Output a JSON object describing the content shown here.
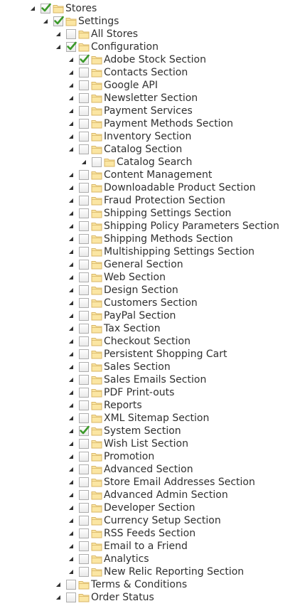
{
  "tree": [
    {
      "label": "Stores",
      "depth": 0,
      "checked": true
    },
    {
      "label": "Settings",
      "depth": 1,
      "checked": true
    },
    {
      "label": "All Stores",
      "depth": 2,
      "checked": false
    },
    {
      "label": "Configuration",
      "depth": 2,
      "checked": true
    },
    {
      "label": "Adobe Stock Section",
      "depth": 3,
      "checked": true
    },
    {
      "label": "Contacts Section",
      "depth": 3,
      "checked": false
    },
    {
      "label": "Google API",
      "depth": 3,
      "checked": false
    },
    {
      "label": "Newsletter Section",
      "depth": 3,
      "checked": false
    },
    {
      "label": "Payment Services",
      "depth": 3,
      "checked": false
    },
    {
      "label": "Payment Methods Section",
      "depth": 3,
      "checked": false
    },
    {
      "label": "Inventory Section",
      "depth": 3,
      "checked": false
    },
    {
      "label": "Catalog Section",
      "depth": 3,
      "checked": false
    },
    {
      "label": "Catalog Search",
      "depth": 4,
      "checked": false
    },
    {
      "label": "Content Management",
      "depth": 3,
      "checked": false
    },
    {
      "label": "Downloadable Product Section",
      "depth": 3,
      "checked": false
    },
    {
      "label": "Fraud Protection Section",
      "depth": 3,
      "checked": false
    },
    {
      "label": "Shipping Settings Section",
      "depth": 3,
      "checked": false
    },
    {
      "label": "Shipping Policy Parameters Section",
      "depth": 3,
      "checked": false
    },
    {
      "label": "Shipping Methods Section",
      "depth": 3,
      "checked": false
    },
    {
      "label": "Multishipping Settings Section",
      "depth": 3,
      "checked": false
    },
    {
      "label": "General Section",
      "depth": 3,
      "checked": false
    },
    {
      "label": "Web Section",
      "depth": 3,
      "checked": false
    },
    {
      "label": "Design Section",
      "depth": 3,
      "checked": false
    },
    {
      "label": "Customers Section",
      "depth": 3,
      "checked": false
    },
    {
      "label": "PayPal Section",
      "depth": 3,
      "checked": false
    },
    {
      "label": "Tax Section",
      "depth": 3,
      "checked": false
    },
    {
      "label": "Checkout Section",
      "depth": 3,
      "checked": false
    },
    {
      "label": "Persistent Shopping Cart",
      "depth": 3,
      "checked": false
    },
    {
      "label": "Sales Section",
      "depth": 3,
      "checked": false
    },
    {
      "label": "Sales Emails Section",
      "depth": 3,
      "checked": false
    },
    {
      "label": "PDF Print-outs",
      "depth": 3,
      "checked": false
    },
    {
      "label": "Reports",
      "depth": 3,
      "checked": false
    },
    {
      "label": "XML Sitemap Section",
      "depth": 3,
      "checked": false
    },
    {
      "label": "System Section",
      "depth": 3,
      "checked": true
    },
    {
      "label": "Wish List Section",
      "depth": 3,
      "checked": false
    },
    {
      "label": "Promotion",
      "depth": 3,
      "checked": false
    },
    {
      "label": "Advanced Section",
      "depth": 3,
      "checked": false
    },
    {
      "label": "Store Email Addresses Section",
      "depth": 3,
      "checked": false
    },
    {
      "label": "Advanced Admin Section",
      "depth": 3,
      "checked": false
    },
    {
      "label": "Developer Section",
      "depth": 3,
      "checked": false
    },
    {
      "label": "Currency Setup Section",
      "depth": 3,
      "checked": false
    },
    {
      "label": "RSS Feeds Section",
      "depth": 3,
      "checked": false
    },
    {
      "label": "Email to a Friend",
      "depth": 3,
      "checked": false
    },
    {
      "label": "Analytics",
      "depth": 3,
      "checked": false
    },
    {
      "label": "New Relic Reporting Section",
      "depth": 3,
      "checked": false
    },
    {
      "label": "Terms & Conditions",
      "depth": 2,
      "checked": false
    },
    {
      "label": "Order Status",
      "depth": 2,
      "checked": false
    }
  ],
  "icons": {
    "expander": "triangle-expanded-icon",
    "folder": "folder-icon",
    "check": "checkmark-icon"
  },
  "colors": {
    "check": "#3c9a2a",
    "folder_light": "#fbe6a3",
    "folder_dark": "#d8b565",
    "checkbox_border": "#adadad",
    "text": "#303030"
  }
}
